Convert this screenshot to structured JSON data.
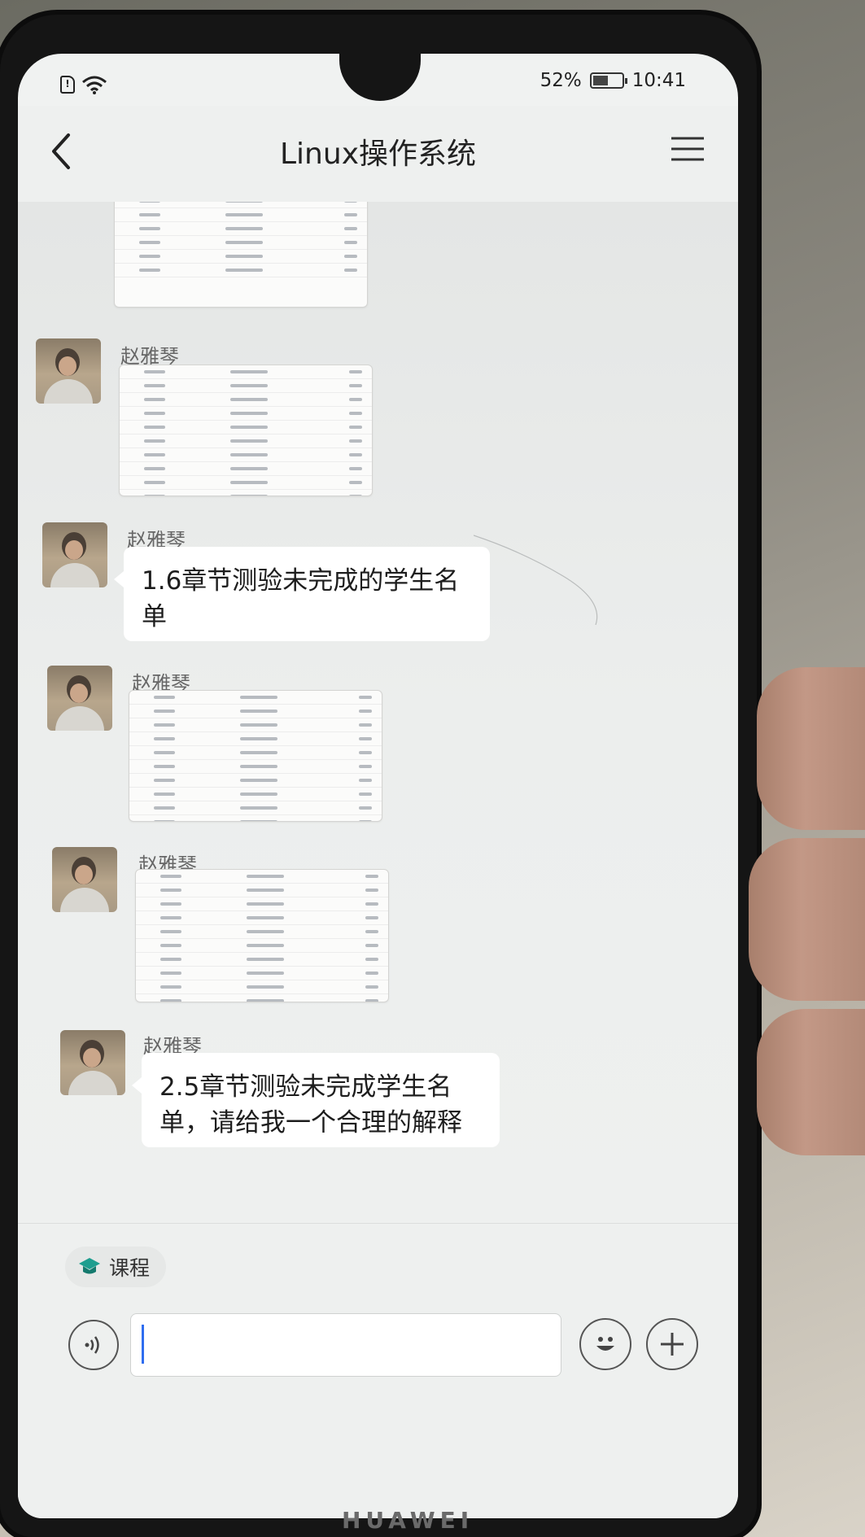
{
  "status": {
    "battery": "52%",
    "battery_level": 0.52,
    "time": "10:41",
    "sim_glyph": "!"
  },
  "header": {
    "title": "Linux操作系统"
  },
  "messages": [
    {
      "type": "image",
      "sender": ""
    },
    {
      "type": "image",
      "sender": "赵雅琴"
    },
    {
      "type": "text",
      "sender": "赵雅琴",
      "text": "1.6章节测验未完成的学生名单"
    },
    {
      "type": "image",
      "sender": "赵雅琴"
    },
    {
      "type": "image",
      "sender": "赵雅琴"
    },
    {
      "type": "text",
      "sender": "赵雅琴",
      "text": "2.5章节测验未完成学生名单，请给我一个合理的解释"
    }
  ],
  "bottom": {
    "course_chip": "课程",
    "input_value": "",
    "input_placeholder": ""
  },
  "brand": "HUAWEI",
  "colors": {
    "accent": "#2f6df0",
    "course_icon": "#1e9e8f",
    "bubble": "#ffffff",
    "chat_bg": "#eceeed"
  },
  "icons": {
    "back": "chevron-left-icon",
    "menu": "hamburger-menu-icon",
    "voice": "voice-wave-icon",
    "emoji": "smiley-icon",
    "plus": "plus-icon",
    "course": "graduation-cap-icon"
  }
}
